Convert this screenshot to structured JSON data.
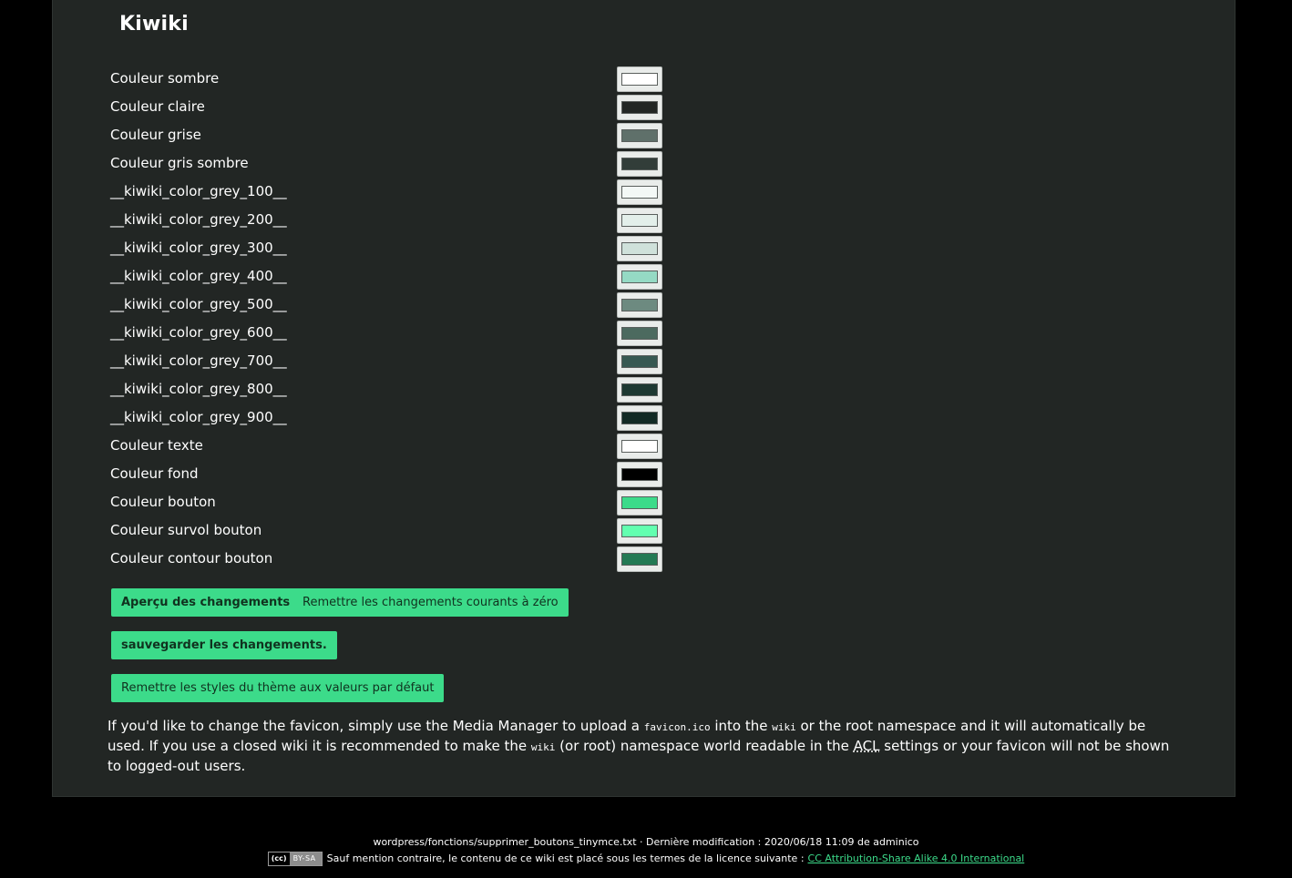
{
  "panel": {
    "title": "Kiwiki"
  },
  "colors": [
    {
      "label": "Couleur sombre",
      "value": "#ffffff"
    },
    {
      "label": "Couleur claire",
      "value": "#222624"
    },
    {
      "label": "Couleur grise",
      "value": "#5f706a"
    },
    {
      "label": "Couleur gris sombre",
      "value": "#323d39"
    },
    {
      "label": "__kiwiki_color_grey_100__",
      "value": "#f3f8f6"
    },
    {
      "label": "__kiwiki_color_grey_200__",
      "value": "#e3efea"
    },
    {
      "label": "__kiwiki_color_grey_300__",
      "value": "#cfe1da"
    },
    {
      "label": "__kiwiki_color_grey_400__",
      "value": "#95dac4"
    },
    {
      "label": "__kiwiki_color_grey_500__",
      "value": "#6d8a80"
    },
    {
      "label": "__kiwiki_color_grey_600__",
      "value": "#4c6a5f"
    },
    {
      "label": "__kiwiki_color_grey_700__",
      "value": "#375952"
    },
    {
      "label": "__kiwiki_color_grey_800__",
      "value": "#1d3932"
    },
    {
      "label": "__kiwiki_color_grey_900__",
      "value": "#122a24"
    },
    {
      "label": "Couleur texte",
      "value": "#ffffff"
    },
    {
      "label": "Couleur fond",
      "value": "#000000"
    },
    {
      "label": "Couleur bouton",
      "value": "#3cdb8a"
    },
    {
      "label": "Couleur survol bouton",
      "value": "#62ffb0"
    },
    {
      "label": "Couleur contour bouton",
      "value": "#237a54"
    }
  ],
  "buttons": {
    "preview": "Aperçu des changements",
    "reset_current": "Remettre les changements courants à zéro",
    "save": "sauvegarder les changements.",
    "reset_defaults": "Remettre les styles du thème aux valeurs par défaut"
  },
  "info": {
    "part1": "If you'd like to change the favicon, simply use the Media Manager to upload a ",
    "code1": "favicon.ico",
    "part2": " into the ",
    "code2": "wiki",
    "part3": " or the root namespace and it will automatically be used. If you use a closed wiki it is recommended to make the ",
    "code3": "wiki",
    "part4": " (or root) namespace world readable in the ",
    "abbr": "ACL",
    "part5": " settings or your favicon will not be shown to logged-out users."
  },
  "footer": {
    "path_line": "wordpress/fonctions/supprimer_boutons_tinymce.txt · Dernière modification : 2020/06/18 11:09 de adminico",
    "badge_logo": "(cc)",
    "badge_text": "BY-SA",
    "license_text": "Sauf mention contraire, le contenu de ce wiki est placé sous les termes de la licence suivante :",
    "license_link": "CC Attribution-Share Alike 4.0 International"
  },
  "theme": {
    "accent": "#3cdb8a",
    "panel_bg": "#222624",
    "page_bg": "#000000"
  }
}
